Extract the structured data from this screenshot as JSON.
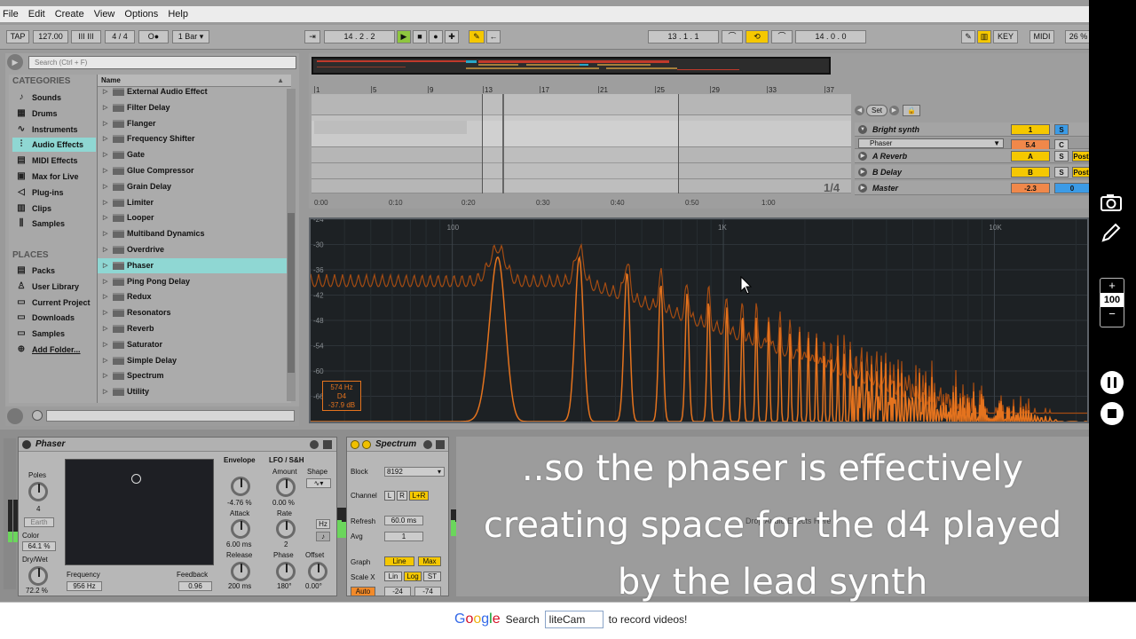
{
  "menubar": [
    "File",
    "Edit",
    "Create",
    "View",
    "Options",
    "Help"
  ],
  "control_bar": {
    "tap": "TAP",
    "tempo": "127.00",
    "nudge": "III III",
    "signature": "4 / 4",
    "metro": "O●",
    "quantize": "1 Bar",
    "arrangement_position": "14 .  2 .  2",
    "loop_start": "13 .  1 .  1",
    "loop_length": "14 .  0 .  0",
    "key": "KEY",
    "midi": "MIDI",
    "cpu": "26 %"
  },
  "browser": {
    "search_placeholder": "Search (Ctrl + F)",
    "categories_title": "CATEGORIES",
    "categories": [
      {
        "label": "Sounds",
        "icon": "♪"
      },
      {
        "label": "Drums",
        "icon": "▦"
      },
      {
        "label": "Instruments",
        "icon": "∿"
      },
      {
        "label": "Audio Effects",
        "icon": "⫶"
      },
      {
        "label": "MIDI Effects",
        "icon": "▤"
      },
      {
        "label": "Max for Live",
        "icon": "▣"
      },
      {
        "label": "Plug-ins",
        "icon": "◁"
      },
      {
        "label": "Clips",
        "icon": "▥"
      },
      {
        "label": "Samples",
        "icon": "⫼"
      }
    ],
    "places_title": "PLACES",
    "places": [
      {
        "label": "Packs",
        "icon": "▤"
      },
      {
        "label": "User Library",
        "icon": "♙"
      },
      {
        "label": "Current Project",
        "icon": "▭"
      },
      {
        "label": "Downloads",
        "icon": "▭"
      },
      {
        "label": "Samples",
        "icon": "▭"
      },
      {
        "label": "Add Folder...",
        "icon": "⊕"
      }
    ],
    "column_header": "Name",
    "items": [
      "External Audio Effect",
      "Filter Delay",
      "Flanger",
      "Frequency Shifter",
      "Gate",
      "Glue Compressor",
      "Grain Delay",
      "Limiter",
      "Looper",
      "Multiband Dynamics",
      "Overdrive",
      "Phaser",
      "Ping Pong Delay",
      "Redux",
      "Resonators",
      "Reverb",
      "Saturator",
      "Simple Delay",
      "Spectrum",
      "Utility"
    ],
    "selected_item": "Phaser"
  },
  "arrangement": {
    "bar_numbers": [
      "1",
      "5",
      "9",
      "13",
      "17",
      "21",
      "25",
      "29",
      "33",
      "37"
    ],
    "time_labels": [
      "0:00",
      "0:10",
      "0:20",
      "0:30",
      "0:40",
      "0:50",
      "1:00"
    ],
    "quantization": "1/4",
    "set_label": "Set",
    "tracks": [
      {
        "name": "Bright synth",
        "a": "1",
        "b": "S",
        "expanded": true
      },
      {
        "name": "Phaser",
        "a": "5.4",
        "b": "C",
        "device_row": true
      },
      {
        "name": "A Reverb",
        "a": "A",
        "b": "S",
        "c": "Post"
      },
      {
        "name": "B Delay",
        "a": "B",
        "b": "S",
        "c": "Post"
      },
      {
        "name": "Master",
        "a": "-2.3",
        "b": "0"
      }
    ]
  },
  "spectrum_view": {
    "db_labels": [
      "-24",
      "-30",
      "-36",
      "-42",
      "-48",
      "-54",
      "-60",
      "-66"
    ],
    "freq_labels": [
      "100",
      "1K",
      "10K"
    ],
    "readout": {
      "freq": "574 Hz",
      "note": "D4",
      "db": "-37.9 dB"
    },
    "colors": {
      "peak": "#e4731e",
      "avg": "#a54c12",
      "bg": "#1d2124"
    }
  },
  "phaser_device": {
    "title": "Phaser",
    "poles_label": "Poles",
    "poles_value": "4",
    "earth_label": "Earth",
    "color_label": "Color",
    "color_value": "64.1 %",
    "drywet_label": "Dry/Wet",
    "drywet_value": "72.2 %",
    "frequency_label": "Frequency",
    "frequency_value": "956 Hz",
    "feedback_label": "Feedback",
    "feedback_value": "0.96",
    "envelope_label": "Envelope",
    "envelope_value": "-4.76 %",
    "attack_label": "Attack",
    "attack_value": "6.00 ms",
    "release_label": "Release",
    "release_value": "200 ms",
    "lfo_label": "LFO / S&H",
    "amount_label": "Amount",
    "amount_value": "0.00 %",
    "shape_label": "Shape",
    "rate_label": "Rate",
    "rate_value": "2",
    "hz_label": "Hz",
    "phase_label": "Phase",
    "phase_value": "180°",
    "offset_label": "Offset",
    "offset_value": "0.00°"
  },
  "spectrum_device": {
    "title": "Spectrum",
    "block_label": "Block",
    "block_value": "8192",
    "channel_label": "Channel",
    "channel_l": "L",
    "channel_r": "R",
    "channel_lr": "L+R",
    "refresh_label": "Refresh",
    "refresh_value": "60.0 ms",
    "avg_label": "Avg",
    "avg_value": "1",
    "graph_label": "Graph",
    "graph_line": "Line",
    "graph_max": "Max",
    "scalex_label": "Scale X",
    "scale_lin": "Lin",
    "scale_log": "Log",
    "scale_st": "ST",
    "auto_label": "Auto",
    "range_low": "-24",
    "range_high": "-74"
  },
  "drop_hint": "Drop Audio Effects Here",
  "subtitle": "..so the phaser is effectively creating space for the d4 played by the lead synth",
  "overlay": {
    "zoom_plus": "+",
    "zoom_value": "100",
    "zoom_minus": "−"
  },
  "bottom": {
    "google_logo": "Google",
    "search_label": "Search",
    "search_value": "liteCam",
    "tagline": "to record videos!"
  }
}
